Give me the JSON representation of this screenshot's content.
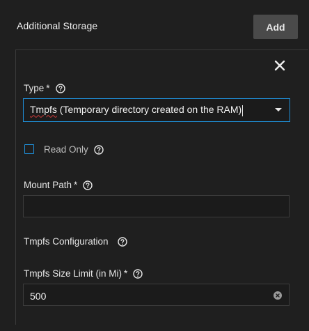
{
  "section": {
    "title": "Additional Storage",
    "add_label": "Add"
  },
  "form": {
    "type": {
      "label": "Type",
      "required_marker": "*",
      "value_prefix": "Tmpfs",
      "value_rest": " (Temporary directory created on the RAM)"
    },
    "read_only": {
      "label": "Read Only",
      "checked": false
    },
    "mount_path": {
      "label": "Mount Path",
      "required_marker": "*",
      "value": ""
    },
    "tmpfs_config": {
      "label": "Tmpfs Configuration"
    },
    "size_limit": {
      "label": "Tmpfs Size Limit (in Mi)",
      "required_marker": "*",
      "value": "500"
    }
  },
  "icons": {
    "close": "close-icon",
    "help": "help-icon",
    "dropdown": "chevron-down-icon",
    "clear": "clear-icon"
  },
  "colors": {
    "accent": "#1f8fd8",
    "button_bg": "#4a4a4a",
    "background": "#1f1f1f"
  }
}
